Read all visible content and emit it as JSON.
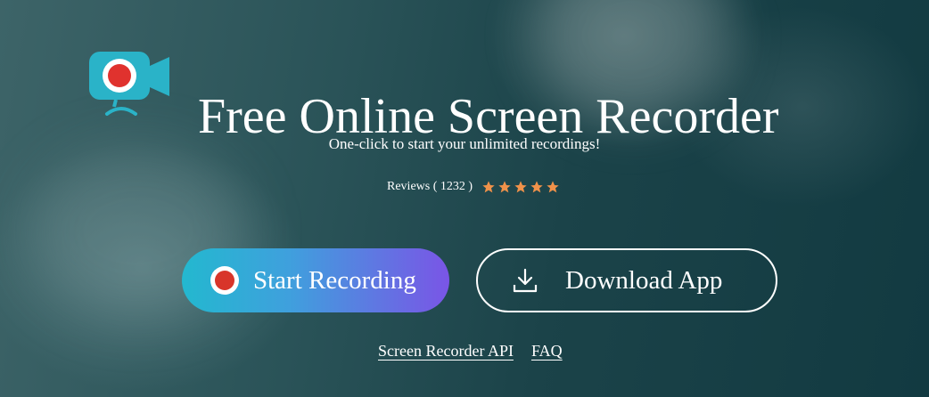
{
  "hero": {
    "title": "Free Online Screen Recorder",
    "subtitle": "One-click to start your unlimited recordings!",
    "logo_icon": "camera-record-icon",
    "colors": {
      "background": "#1b4349",
      "start_gradient_from": "#23b8cf",
      "start_gradient_to": "#7a55e6",
      "star": "#f0924a",
      "logo": "#2ab3c8",
      "record_dot": "#e0322e"
    }
  },
  "reviews": {
    "label": "Reviews ( 1232 )",
    "rating": 5,
    "max_rating": 5
  },
  "buttons": {
    "start_recording": {
      "label": "Start Recording",
      "icon": "record-icon"
    },
    "download_app": {
      "label": "Download App",
      "icon": "download-icon"
    }
  },
  "links": {
    "api": "Screen Recorder API",
    "faq": "FAQ"
  }
}
